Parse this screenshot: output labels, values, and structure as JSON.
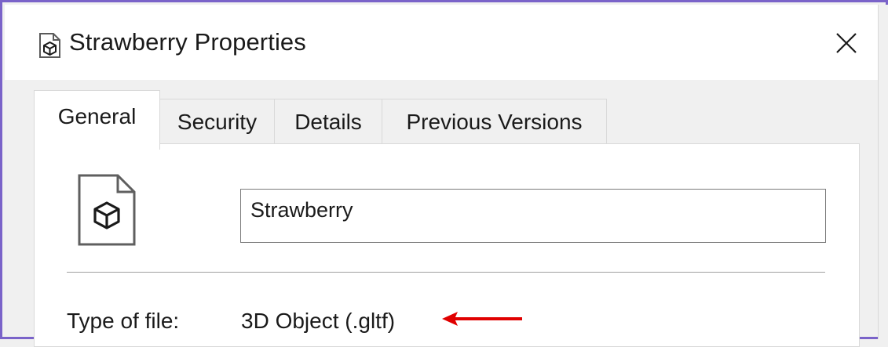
{
  "window": {
    "title": "Strawberry Properties",
    "title_icon": "3d-object-icon",
    "close_icon": "close-icon"
  },
  "tabs": [
    {
      "label": "General",
      "active": true
    },
    {
      "label": "Security",
      "active": false
    },
    {
      "label": "Details",
      "active": false
    },
    {
      "label": "Previous Versions",
      "active": false
    }
  ],
  "general": {
    "file_icon": "3d-object-file-icon",
    "file_name": "Strawberry",
    "type_label": "Type of file:",
    "type_value": "3D Object (.gltf)"
  },
  "annotation": {
    "arrow_color": "#e00000"
  },
  "colors": {
    "window_border": "#7a63c9",
    "titlebar_bg": "#ffffff",
    "dialog_bg": "#f0f0f0"
  }
}
